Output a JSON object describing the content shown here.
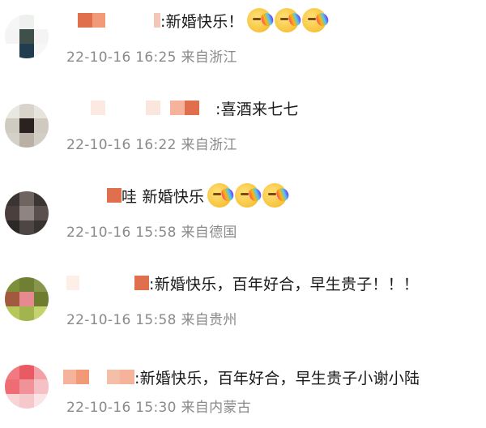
{
  "comments": [
    {
      "text": ":新婚快乐！",
      "time": "22-10-16 16:25",
      "location": "来自浙江",
      "emoji_icon": "party-face-rainbow-emoji",
      "emoji_count": 3
    },
    {
      "text": ":喜酒来七七",
      "time": "22-10-16 16:22",
      "location": "来自浙江",
      "emoji_count": 0
    },
    {
      "text": "哇 新婚快乐",
      "time": "22-10-16 15:58",
      "location": "来自德国",
      "emoji_icon": "party-face-rainbow-emoji",
      "emoji_count": 3
    },
    {
      "text": ":新婚快乐，百年好合，早生贵子！！！",
      "time": "22-10-16 15:58",
      "location": "来自贵州",
      "emoji_count": 0
    },
    {
      "text": ":新婚快乐，百年好合，早生贵子小谢小陆",
      "time": "22-10-16 15:30",
      "location": "来自内蒙古",
      "emoji_count": 0
    }
  ]
}
